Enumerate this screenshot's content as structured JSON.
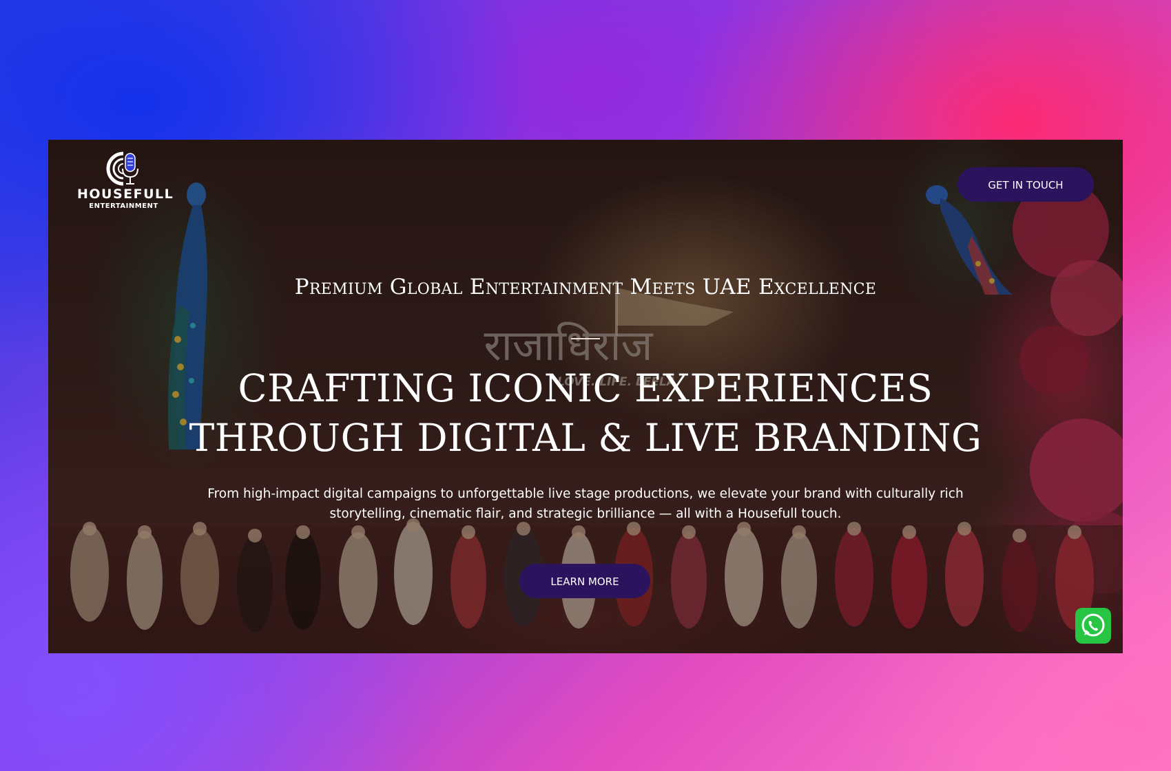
{
  "brand": {
    "name": "HOUSEFULL",
    "tagline": "ENTERTAINMENT",
    "logo_icon": "microphone-vinyl-icon"
  },
  "header": {
    "cta_label": "GET IN TOUCH"
  },
  "hero": {
    "subheading": "Premium Global Entertainment Meets UAE Excellence",
    "headline_line1": "CRAFTING ICONIC EXPERIENCES",
    "headline_line2": "THROUGH DIGITAL & LIVE BRANDING",
    "description": "From high-impact digital campaigns to unforgettable live stage productions, we elevate your brand with culturally rich storytelling, cinematic flair, and strategic brilliance — all with a Housefull touch.",
    "cta_label": "LEARN MORE",
    "background_stage_text": "राजाधिराज",
    "background_stage_subtext": "LOVE. LIFE. LEELA"
  },
  "floating": {
    "whatsapp_icon": "whatsapp-icon"
  },
  "colors": {
    "button": "#2b135e",
    "whatsapp": "#28c444",
    "text": "#ffffff"
  }
}
